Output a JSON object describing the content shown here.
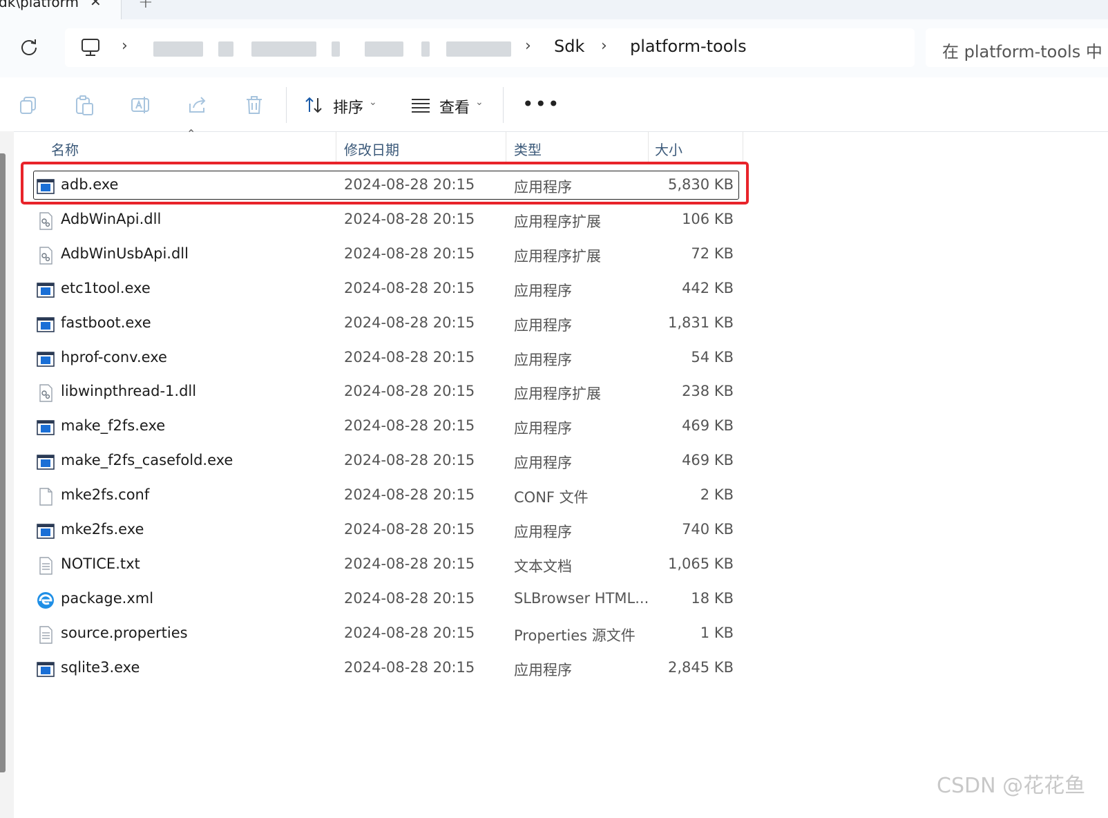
{
  "tab": {
    "title": "dk\\platform",
    "close": "✕",
    "new": "+"
  },
  "address": {
    "breadcrumb": [
      "Sdk",
      "platform-tools"
    ],
    "search_placeholder": "在 platform-tools 中"
  },
  "commands": {
    "sort_label": "排序",
    "view_label": "查看",
    "more_label": "•••"
  },
  "columns": {
    "name": "名称",
    "date": "修改日期",
    "type": "类型",
    "size": "大小"
  },
  "files": [
    {
      "name": "adb.exe",
      "date": "2024-08-28 20:15",
      "type": "应用程序",
      "size": "5,830 KB",
      "icon": "exe-icon",
      "selected": true
    },
    {
      "name": "AdbWinApi.dll",
      "date": "2024-08-28 20:15",
      "type": "应用程序扩展",
      "size": "106 KB",
      "icon": "dll-icon"
    },
    {
      "name": "AdbWinUsbApi.dll",
      "date": "2024-08-28 20:15",
      "type": "应用程序扩展",
      "size": "72 KB",
      "icon": "dll-icon"
    },
    {
      "name": "etc1tool.exe",
      "date": "2024-08-28 20:15",
      "type": "应用程序",
      "size": "442 KB",
      "icon": "exe-icon"
    },
    {
      "name": "fastboot.exe",
      "date": "2024-08-28 20:15",
      "type": "应用程序",
      "size": "1,831 KB",
      "icon": "exe-icon"
    },
    {
      "name": "hprof-conv.exe",
      "date": "2024-08-28 20:15",
      "type": "应用程序",
      "size": "54 KB",
      "icon": "exe-icon"
    },
    {
      "name": "libwinpthread-1.dll",
      "date": "2024-08-28 20:15",
      "type": "应用程序扩展",
      "size": "238 KB",
      "icon": "dll-icon"
    },
    {
      "name": "make_f2fs.exe",
      "date": "2024-08-28 20:15",
      "type": "应用程序",
      "size": "469 KB",
      "icon": "exe-icon"
    },
    {
      "name": "make_f2fs_casefold.exe",
      "date": "2024-08-28 20:15",
      "type": "应用程序",
      "size": "469 KB",
      "icon": "exe-icon"
    },
    {
      "name": "mke2fs.conf",
      "date": "2024-08-28 20:15",
      "type": "CONF 文件",
      "size": "2 KB",
      "icon": "blank-file-icon"
    },
    {
      "name": "mke2fs.exe",
      "date": "2024-08-28 20:15",
      "type": "应用程序",
      "size": "740 KB",
      "icon": "exe-icon"
    },
    {
      "name": "NOTICE.txt",
      "date": "2024-08-28 20:15",
      "type": "文本文档",
      "size": "1,065 KB",
      "icon": "text-file-icon"
    },
    {
      "name": "package.xml",
      "date": "2024-08-28 20:15",
      "type": "SLBrowser HTML...",
      "size": "18 KB",
      "icon": "browser-icon"
    },
    {
      "name": "source.properties",
      "date": "2024-08-28 20:15",
      "type": "Properties 源文件",
      "size": "1 KB",
      "icon": "text-file-icon"
    },
    {
      "name": "sqlite3.exe",
      "date": "2024-08-28 20:15",
      "type": "应用程序",
      "size": "2,845 KB",
      "icon": "exe-icon"
    }
  ],
  "watermark": "CSDN @花花鱼",
  "colors": {
    "highlight_red": "#e8232a",
    "header_text": "#3c5a7a",
    "exe_blue": "#1a6fd6"
  }
}
